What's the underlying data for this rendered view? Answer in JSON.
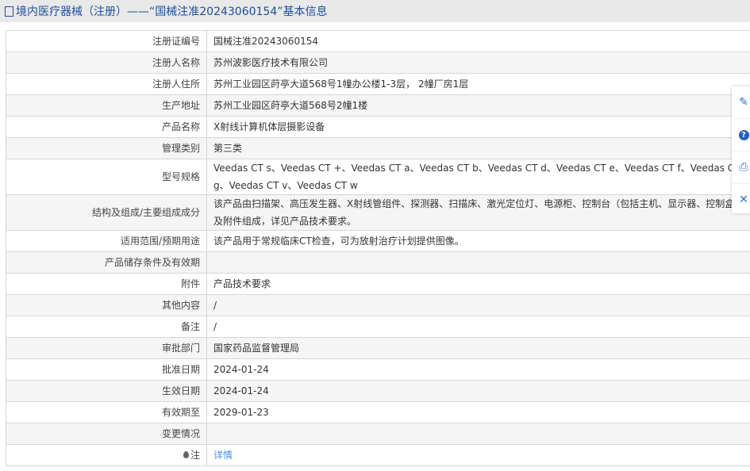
{
  "title": "境内医疗器械（注册）——“国械注准20243060154”基本信息",
  "rows": [
    {
      "label": "注册证编号",
      "value": "国械注准20243060154"
    },
    {
      "label": "注册人名称",
      "value": "苏州波影医疗技术有限公司"
    },
    {
      "label": "注册人住所",
      "value": "苏州工业园区莳亭大道568号1幢办公楼1-3层， 2幢厂房1层"
    },
    {
      "label": "生产地址",
      "value": "苏州工业园区莳亭大道568号2幢1楼"
    },
    {
      "label": "产品名称",
      "value": "X射线计算机体层摄影设备"
    },
    {
      "label": "管理类别",
      "value": "第三类"
    },
    {
      "label": "型号规格",
      "value": "Veedas CT s、Veedas CT +、Veedas CT a、Veedas CT b、Veedas CT d、Veedas CT e、Veedas CT f、Veedas CT g、Veedas CT v、Veedas CT w"
    },
    {
      "label": "结构及组成/主要组成成分",
      "value": "该产品由扫描架、高压发生器、X射线管组件、探测器、扫描床、激光定位灯、电源柜、控制台（包括主机、显示器、控制盒）及附件组成，详见产品技术要求。"
    },
    {
      "label": "适用范围/预期用途",
      "value": "该产品用于常规临床CT检查，可为放射治疗计划提供图像。"
    },
    {
      "label": "产品储存条件及有效期",
      "value": ""
    },
    {
      "label": "附件",
      "value": "产品技术要求"
    },
    {
      "label": "其他内容",
      "value": "/"
    },
    {
      "label": "备注",
      "value": "/"
    },
    {
      "label": "审批部门",
      "value": "国家药品监督管理局"
    },
    {
      "label": "批准日期",
      "value": "2024-01-24"
    },
    {
      "label": "生效日期",
      "value": "2024-01-24"
    },
    {
      "label": "有效期至",
      "value": "2029-01-23"
    },
    {
      "label": "变更情况",
      "value": ""
    }
  ],
  "note": {
    "label": "注",
    "link": "详情"
  },
  "tools": {
    "help": "?",
    "close": "✕"
  }
}
